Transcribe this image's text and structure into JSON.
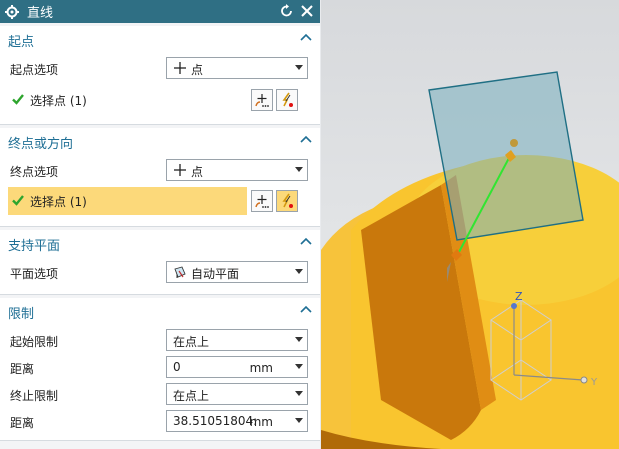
{
  "dialog": {
    "title": "直线",
    "groups": {
      "start": {
        "title": "起点",
        "option_label": "起点选项",
        "option_value": "点",
        "select_label": "选择点 (1)"
      },
      "end": {
        "title": "终点或方向",
        "option_label": "终点选项",
        "option_value": "点",
        "select_label": "选择点 (1)"
      },
      "plane": {
        "title": "支持平面",
        "option_label": "平面选项",
        "option_value": "自动平面"
      },
      "limits": {
        "title": "限制",
        "start_limit_label": "起始限制",
        "start_limit_value": "在点上",
        "distance1_label": "距离",
        "distance1_value": "0",
        "distance1_unit": "mm",
        "end_limit_label": "终止限制",
        "end_limit_value": "在点上",
        "distance2_label": "距离",
        "distance2_value": "38.51051804:",
        "distance2_unit": "mm"
      }
    }
  },
  "viewport": {
    "axis_z": "Z",
    "axis_y": "Y"
  },
  "colors": {
    "title_bg": "#2f6f84",
    "accent": "#1f6f95",
    "highlight": "#fcd97a",
    "check": "#2ea52e",
    "part_yellow": "#f7c33b",
    "part_orange": "#c9780c"
  }
}
